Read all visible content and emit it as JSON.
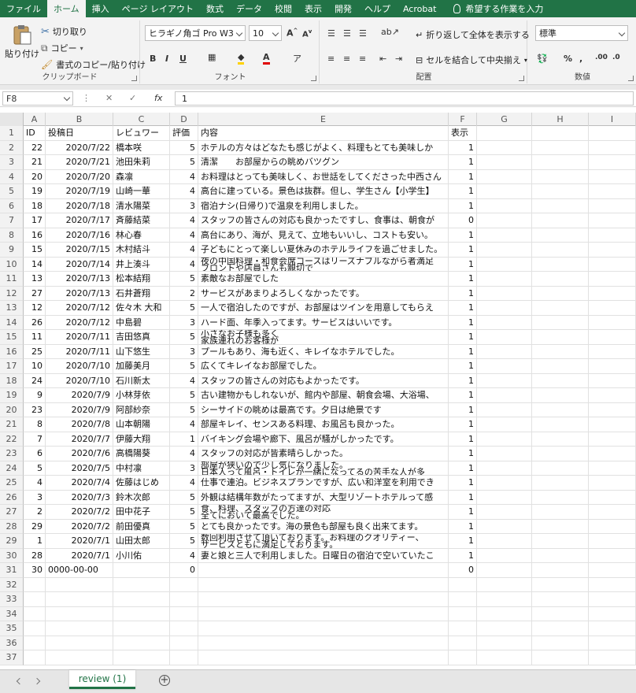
{
  "menu": {
    "tabs": [
      "ファイル",
      "ホーム",
      "挿入",
      "ページ レイアウト",
      "数式",
      "データ",
      "校閲",
      "表示",
      "開発",
      "ヘルプ",
      "Acrobat"
    ],
    "active_tab": "ホーム",
    "tell_me": "希望する作業を入力"
  },
  "ribbon": {
    "clipboard": {
      "label": "クリップボード",
      "paste": "貼り付け",
      "cut": "切り取り",
      "copy": "コピー",
      "format_painter": "書式のコピー/貼り付け"
    },
    "font": {
      "label": "フォント",
      "font_name": "ヒラギノ角ゴ Pro W3",
      "font_size": "10",
      "bold": "B",
      "italic": "I",
      "underline": "U"
    },
    "alignment": {
      "label": "配置",
      "wrap_text": "折り返して全体を表示する",
      "merge_center": "セルを結合して中央揃え"
    },
    "number": {
      "label": "数値",
      "format": "標準",
      "percent": "%",
      "comma": ","
    }
  },
  "formula_bar": {
    "name_box": "F8",
    "fx": "fx",
    "value": "1"
  },
  "columns": [
    "A",
    "B",
    "C",
    "D",
    "E",
    "F",
    "G",
    "H",
    "I"
  ],
  "rows": [
    {
      "n": "1",
      "A": "ID",
      "B": "投稿日",
      "C": "レビュワー",
      "D": "評価",
      "E": "内容",
      "F": "表示",
      "header": true
    },
    {
      "n": "2",
      "A": "22",
      "B": "2020/7/22",
      "C": "橋本咲",
      "D": "5",
      "E": "ホテルの方々はどなたも感じがよく、料理もとても美味しか",
      "F": "1"
    },
    {
      "n": "3",
      "A": "21",
      "B": "2020/7/21",
      "C": "池田朱莉",
      "D": "5",
      "E": "清潔　　お部屋からの眺めバツグン",
      "F": "1"
    },
    {
      "n": "4",
      "A": "20",
      "B": "2020/7/20",
      "C": "森凛",
      "D": "4",
      "E": "お料理はとっても美味しく、お世話をしてくださった中西さん",
      "F": "1"
    },
    {
      "n": "5",
      "A": "19",
      "B": "2020/7/19",
      "C": "山崎一華",
      "D": "4",
      "E": "高台に建っている。景色は抜群。但し、学生さん【小学生】",
      "F": "1"
    },
    {
      "n": "6",
      "A": "18",
      "B": "2020/7/18",
      "C": "清水陽菜",
      "D": "3",
      "E": "宿泊ナシ(日帰り)で温泉を利用しました。",
      "F": "1"
    },
    {
      "n": "7",
      "A": "17",
      "B": "2020/7/17",
      "C": "斉藤結菜",
      "D": "4",
      "E": "スタッフの皆さんの対応も良かったですし、食事は、朝食が",
      "F": "0"
    },
    {
      "n": "8",
      "A": "16",
      "B": "2020/7/16",
      "C": "林心春",
      "D": "4",
      "E": "高台にあり、海が、見えて、立地もいいし、コストも安い。",
      "F": "1"
    },
    {
      "n": "9",
      "A": "15",
      "B": "2020/7/15",
      "C": "木村結斗",
      "D": "4",
      "E": "子どもにとって楽しい夏休みのホテルライフを過ごせました。",
      "F": "1"
    },
    {
      "n": "10",
      "A": "14",
      "B": "2020/7/14",
      "C": "井上湊斗",
      "D": "4",
      "E": "夜の中国料理・和食会席コースはリーズナブルながら者満足",
      "E2": "フロントや店員さんも親切で",
      "F": "1",
      "wrap": true
    },
    {
      "n": "11",
      "A": "13",
      "B": "2020/7/13",
      "C": "松本結翔",
      "D": "5",
      "E": "素敵なお部屋でした",
      "F": "1"
    },
    {
      "n": "12",
      "A": "27",
      "B": "2020/7/13",
      "C": "石井蒼翔",
      "D": "2",
      "E": "サービスがあまりよろしくなかったです。",
      "F": "1"
    },
    {
      "n": "13",
      "A": "12",
      "B": "2020/7/12",
      "C": "佐々木 大和",
      "D": "5",
      "E": "一人で宿泊したのですが、お部屋はツインを用意してもらえ",
      "F": "1"
    },
    {
      "n": "14",
      "A": "26",
      "B": "2020/7/12",
      "C": "中島碧",
      "D": "3",
      "E": "ハード面、年季入ってます。サービスはいいです。",
      "F": "1"
    },
    {
      "n": "15",
      "A": "11",
      "B": "2020/7/11",
      "C": "吉田悠真",
      "D": "5",
      "E": "小さなお子様も多く",
      "E2": "家族連れのお客様が",
      "F": "1",
      "wrap": true
    },
    {
      "n": "16",
      "A": "25",
      "B": "2020/7/11",
      "C": "山下悠生",
      "D": "3",
      "E": "プールもあり、海も近く、キレイなホテルでした。",
      "F": "1"
    },
    {
      "n": "17",
      "A": "10",
      "B": "2020/7/10",
      "C": "加藤美月",
      "D": "5",
      "E": "広くてキレイなお部屋でした。",
      "F": "1"
    },
    {
      "n": "18",
      "A": "24",
      "B": "2020/7/10",
      "C": "石川新太",
      "D": "4",
      "E": "スタッフの皆さんの対応もよかったです。",
      "F": "1"
    },
    {
      "n": "19",
      "A": "9",
      "B": "2020/7/9",
      "C": "小林芽依",
      "D": "5",
      "E": "古い建物かもしれないが、館内や部屋、朝食会場、大浴場、",
      "F": "1"
    },
    {
      "n": "20",
      "A": "23",
      "B": "2020/7/9",
      "C": "阿部紗奈",
      "D": "5",
      "E": "シーサイドの眺めは最高です。夕日は絶景です",
      "F": "1"
    },
    {
      "n": "21",
      "A": "8",
      "B": "2020/7/8",
      "C": "山本朝陽",
      "D": "4",
      "E": "部屋キレイ、センスある料理、お風呂も良かった。",
      "F": "1"
    },
    {
      "n": "22",
      "A": "7",
      "B": "2020/7/7",
      "C": "伊藤大翔",
      "D": "1",
      "E": "バイキング会場や廊下、風呂が騒がしかったです。",
      "F": "1"
    },
    {
      "n": "23",
      "A": "6",
      "B": "2020/7/6",
      "C": "高橋陽葵",
      "D": "4",
      "E": "スタッフの対応が皆素晴らしかった。",
      "F": "1"
    },
    {
      "n": "24",
      "A": "5",
      "B": "2020/7/5",
      "C": "中村凛",
      "D": "3",
      "E": "部屋が狭いので少し気になりました。",
      "E2": "日本人って風呂・トイレが一緒になってるの苦手な人が多",
      "F": "1",
      "wrap": true
    },
    {
      "n": "25",
      "A": "4",
      "B": "2020/7/4",
      "C": "佐藤はじめ",
      "D": "4",
      "E": "仕事で連泊。ビジネスプランですが、広い和洋室を利用でき",
      "F": "1"
    },
    {
      "n": "26",
      "A": "3",
      "B": "2020/7/3",
      "C": "鈴木次郎",
      "D": "5",
      "E": "外観は結構年数がたってますが、大型リゾートホテルって感",
      "F": "1"
    },
    {
      "n": "27",
      "A": "2",
      "B": "2020/7/2",
      "C": "田中花子",
      "D": "5",
      "E": "食、料理、スタッフの方達の対応",
      "E2": "全てにおいて最高でした。",
      "F": "1",
      "wrap": true
    },
    {
      "n": "28",
      "A": "29",
      "B": "2020/7/2",
      "C": "前田優真",
      "D": "5",
      "E": "とても良かったです。海の景色も部屋も良く出来てます。",
      "F": "1"
    },
    {
      "n": "29",
      "A": "1",
      "B": "2020/7/1",
      "C": "山田太郎",
      "D": "5",
      "E": "数回利用させて頂いております。お料理のクオリティー、",
      "E2": "サービスともに満足しております。",
      "F": "1",
      "wrap": true
    },
    {
      "n": "30",
      "A": "28",
      "B": "2020/7/1",
      "C": "小川佑",
      "D": "4",
      "E": "妻と娘と三人で利用しました。日曜日の宿泊で空いていたこ",
      "F": "1"
    },
    {
      "n": "31",
      "A": "30",
      "B": "0000-00-00",
      "C": "",
      "D": "0",
      "E": "",
      "F": "0",
      "blong": true
    },
    {
      "n": "32"
    },
    {
      "n": "33"
    },
    {
      "n": "34"
    },
    {
      "n": "35"
    },
    {
      "n": "36"
    },
    {
      "n": "37"
    }
  ],
  "sheet_tab": "review (1)",
  "colors": {
    "excel_green": "#217346"
  }
}
